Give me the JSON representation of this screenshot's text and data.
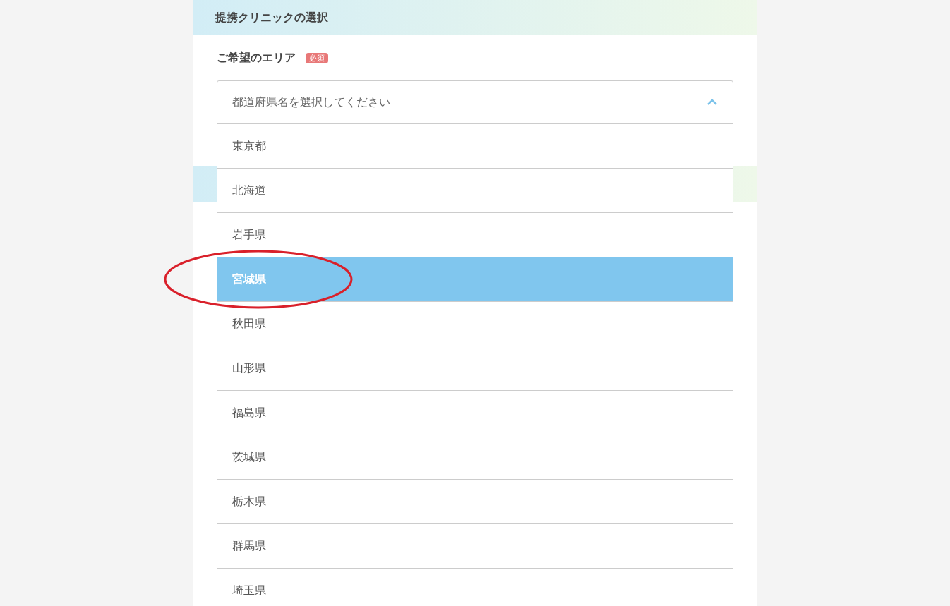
{
  "section": {
    "title": "提携クリニックの選択"
  },
  "field": {
    "label": "ご希望のエリア",
    "badge": "必須",
    "placeholder": "都道府県名を選択してください",
    "expanded": true
  },
  "options": [
    {
      "label": "東京都",
      "selected": false
    },
    {
      "label": "北海道",
      "selected": false
    },
    {
      "label": "岩手県",
      "selected": false
    },
    {
      "label": "宮城県",
      "selected": true
    },
    {
      "label": "秋田県",
      "selected": false
    },
    {
      "label": "山形県",
      "selected": false
    },
    {
      "label": "福島県",
      "selected": false
    },
    {
      "label": "茨城県",
      "selected": false
    },
    {
      "label": "栃木県",
      "selected": false
    },
    {
      "label": "群馬県",
      "selected": false
    },
    {
      "label": "埼玉県",
      "selected": false
    }
  ]
}
